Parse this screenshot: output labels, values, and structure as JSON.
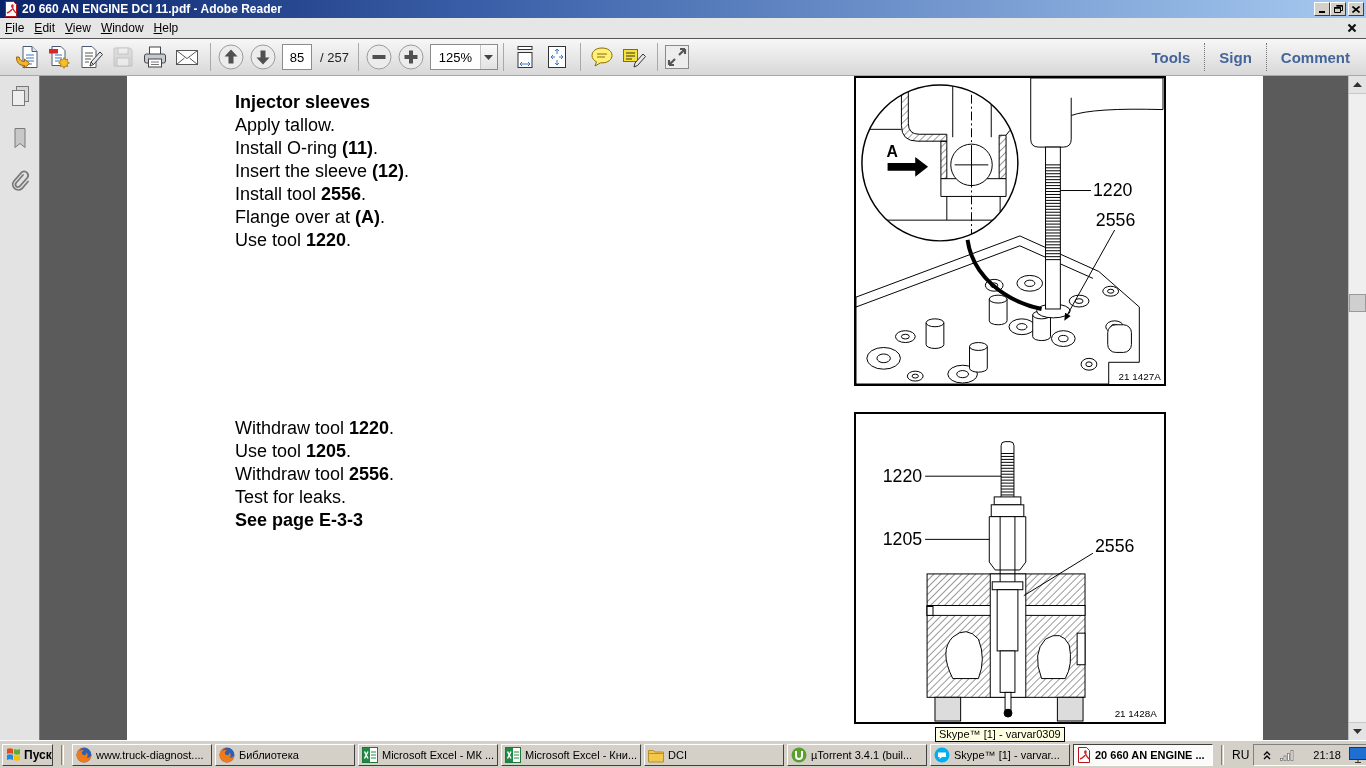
{
  "window": {
    "title": "20 660 AN ENGINE DCI 11.pdf - Adobe Reader"
  },
  "menu": [
    {
      "label": "File"
    },
    {
      "label": "Edit"
    },
    {
      "label": "View"
    },
    {
      "label": "Window"
    },
    {
      "label": "Help"
    }
  ],
  "toolbar": {
    "file_buttons": [
      {
        "kind": "open",
        "disabled": false
      },
      {
        "kind": "create",
        "disabled": false
      },
      {
        "kind": "edit",
        "disabled": false
      },
      {
        "kind": "save",
        "disabled": true
      },
      {
        "kind": "print",
        "disabled": false
      },
      {
        "kind": "email",
        "disabled": false
      }
    ],
    "page_number": "85",
    "page_count": "/ 257",
    "zoom": "125%",
    "view_buttons": [
      {
        "kind": "scroll"
      },
      {
        "kind": "fit"
      }
    ],
    "comment_buttons": [
      {
        "kind": "note"
      },
      {
        "kind": "highlight"
      }
    ],
    "panes": [
      {
        "label": "Tools"
      },
      {
        "label": "Sign"
      },
      {
        "label": "Comment"
      }
    ]
  },
  "page": {
    "blocks": [
      {
        "lines": [
          {
            "kind": "heading",
            "text": "Injector sleeves"
          },
          {
            "kind": "step",
            "text": "Apply tallow."
          },
          {
            "kind": "step",
            "text": "Install O-ring **(11)**."
          },
          {
            "kind": "step",
            "text": "Insert the sleeve **(12)**."
          },
          {
            "kind": "step",
            "text": "Install tool **2556**."
          },
          {
            "kind": "step",
            "text": "Flange over at **(A)**."
          },
          {
            "kind": "step",
            "text": "Use tool **1220**."
          }
        ],
        "figure": {
          "kind": "install",
          "callouts": [
            {
              "text": "A"
            },
            {
              "text": "1220"
            },
            {
              "text": "2556"
            }
          ],
          "code": "21 1427A"
        }
      },
      {
        "lines": [
          {
            "kind": "step",
            "text": "Withdraw tool **1220**."
          },
          {
            "kind": "step",
            "text": "Use tool **1205**."
          },
          {
            "kind": "step",
            "text": "Withdraw tool **2556**."
          },
          {
            "kind": "step",
            "text": "Test for leaks."
          },
          {
            "kind": "reference",
            "text": "See page E-3-3"
          }
        ],
        "figure": {
          "kind": "withdraw",
          "callouts": [
            {
              "text": "1220"
            },
            {
              "text": "1205"
            },
            {
              "text": "2556"
            }
          ],
          "code": "21 1428A"
        }
      }
    ]
  },
  "taskbar": {
    "start": "Пуск",
    "tasks": [
      {
        "kind": "browser",
        "label": "www.truck-diagnost....",
        "selected": false
      },
      {
        "kind": "browser",
        "label": "Библиотека",
        "selected": false
      },
      {
        "kind": "spreadsheet",
        "label": "Microsoft Excel - МК ...",
        "selected": false
      },
      {
        "kind": "spreadsheet",
        "label": "Microsoft Excel - Кни...",
        "selected": false
      },
      {
        "kind": "folder",
        "label": "DCI",
        "selected": false
      },
      {
        "kind": "torrent",
        "label": "µTorrent 3.4.1 (buil...",
        "selected": false
      },
      {
        "kind": "messenger",
        "label": "Skype™ [1] - varvar...",
        "selected": false
      },
      {
        "kind": "pdf",
        "label": "20 660 AN ENGINE ...",
        "selected": true
      }
    ],
    "language": "RU",
    "clock": "21:18"
  },
  "tooltip": {
    "text": "Skype™ [1] - varvar0309"
  }
}
